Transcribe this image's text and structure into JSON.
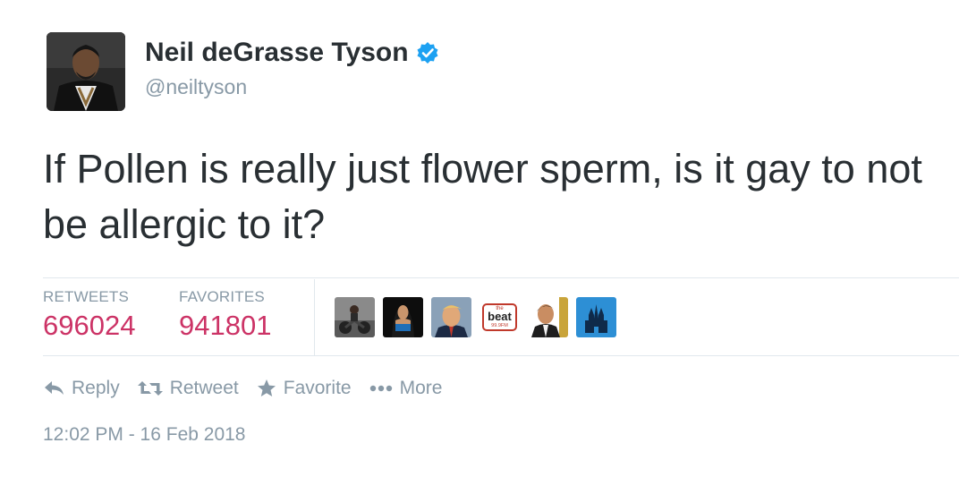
{
  "author": {
    "name": "Neil deGrasse Tyson",
    "handle": "@neiltyson",
    "verified": true
  },
  "tweet": {
    "text": "If Pollen is really just flower sperm, is it gay to not be allergic to it?"
  },
  "stats": {
    "retweets_label": "RETWEETS",
    "retweets_value": "696024",
    "favorites_label": "FAVORITES",
    "favorites_value": "941801"
  },
  "favoriters": [
    "person-on-motorcycle",
    "woman-portrait",
    "trump-portrait",
    "the-beat-logo",
    "man-in-suit",
    "castle-logo"
  ],
  "beat_logo": {
    "top": "the",
    "main": "beat",
    "sub": "99.9FM"
  },
  "actions": {
    "reply": "Reply",
    "retweet": "Retweet",
    "favorite": "Favorite",
    "more": "More"
  },
  "timestamp": "12:02 PM - 16 Feb 2018",
  "colors": {
    "text": "#292f33",
    "muted": "#8899a6",
    "count": "#cc3366",
    "verified": "#1da1f2",
    "divider": "#e1e8ed"
  }
}
